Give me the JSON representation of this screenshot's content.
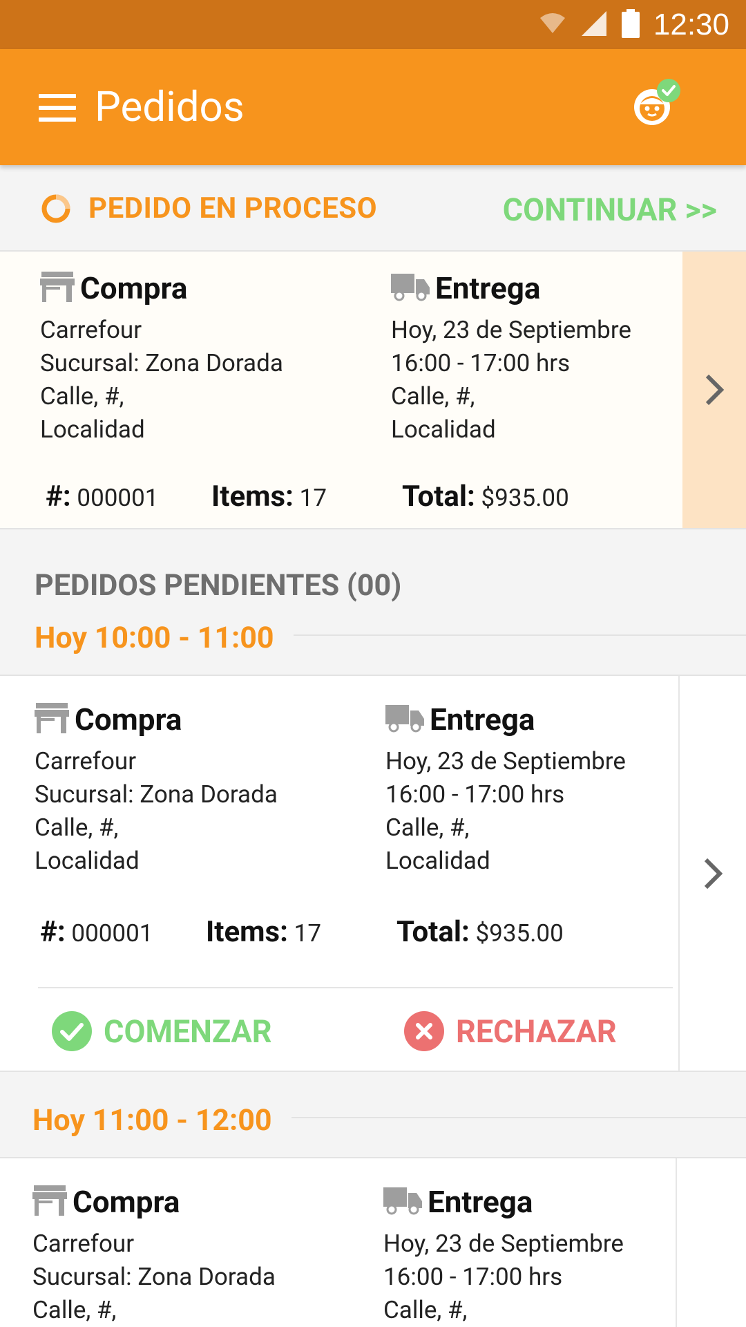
{
  "status_bar": {
    "time": "12:30",
    "icons": [
      "wifi-icon",
      "signal-icon",
      "battery-icon"
    ]
  },
  "app_bar": {
    "title": "Pedidos",
    "menu_icon": "menu-icon",
    "avatar_icon": "avatar-icon"
  },
  "colors": {
    "primary": "#f7941d",
    "status_bar": "#cd7318",
    "success": "#7ed87b",
    "danger": "#ec7171",
    "section_gray": "#6e6e6e"
  },
  "in_process": {
    "label": "PEDIDO EN PROCESO",
    "continue_label": "CONTINUAR >>",
    "order": {
      "compra_title": "Compra",
      "compra_lines": [
        "Carrefour",
        "Sucursal: Zona Dorada",
        "Calle, #,",
        "Localidad"
      ],
      "entrega_title": "Entrega",
      "entrega_lines": [
        "Hoy, 23 de Septiembre",
        "16:00 - 17:00 hrs",
        "Calle, #,",
        "Localidad"
      ],
      "number_label": "#:",
      "number": "000001",
      "items_label": "Items:",
      "items": "17",
      "total_label": "Total:",
      "total": "$935.00"
    }
  },
  "pending": {
    "section_title": "PEDIDOS PENDIENTES (00)",
    "slots": [
      {
        "title": "Hoy 10:00 - 11:00",
        "order": {
          "compra_title": "Compra",
          "compra_lines": [
            "Carrefour",
            "Sucursal: Zona Dorada",
            "Calle, #,",
            "Localidad"
          ],
          "entrega_title": "Entrega",
          "entrega_lines": [
            "Hoy, 23 de Septiembre",
            "16:00 - 17:00 hrs",
            "Calle, #,",
            "Localidad"
          ],
          "number_label": "#:",
          "number": "000001",
          "items_label": "Items:",
          "items": "17",
          "total_label": "Total:",
          "total": "$935.00",
          "start_label": "COMENZAR",
          "reject_label": "RECHAZAR"
        }
      },
      {
        "title": "Hoy 11:00 - 12:00",
        "order": {
          "compra_title": "Compra",
          "compra_lines": [
            "Carrefour",
            "Sucursal: Zona Dorada",
            "Calle, #,"
          ],
          "entrega_title": "Entrega",
          "entrega_lines": [
            "Hoy, 23 de Septiembre",
            "16:00 - 17:00 hrs",
            "Calle, #,"
          ]
        }
      }
    ]
  }
}
